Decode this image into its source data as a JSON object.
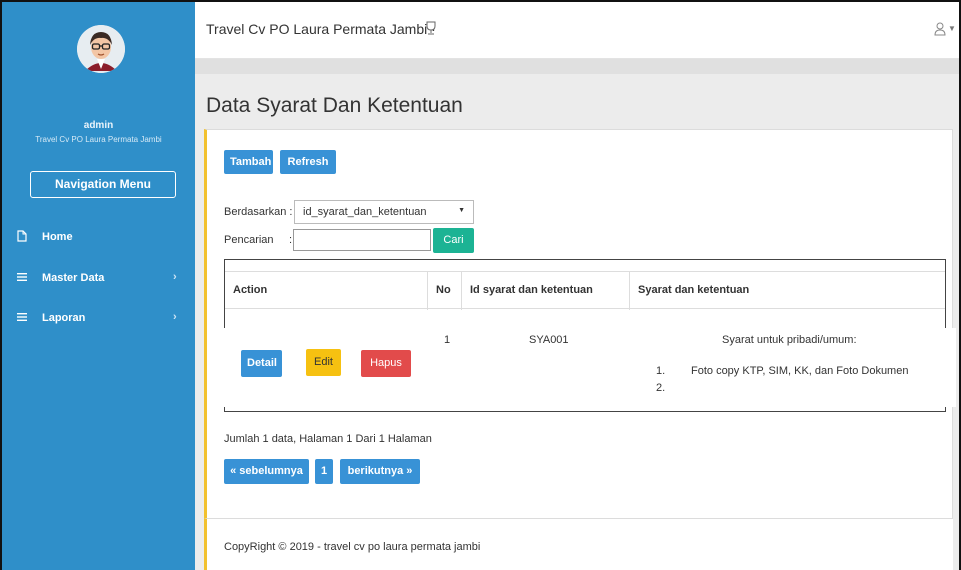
{
  "sidebar": {
    "username": "admin",
    "org": "Travel Cv PO Laura Permata Jambi",
    "nav_button": "Navigation Menu",
    "items": [
      {
        "label": "Home",
        "icon": "file-icon"
      },
      {
        "label": "Master Data",
        "icon": "menu-icon"
      },
      {
        "label": "Laporan",
        "icon": "menu-icon"
      }
    ]
  },
  "topbar": {
    "brand": "Travel Cv PO Laura Permata Jambi ·"
  },
  "page": {
    "title": "Data Syarat Dan Ketentuan"
  },
  "toolbar": {
    "add_label": "Tambah",
    "refresh_label": "Refresh"
  },
  "filter": {
    "by_label": "Berdasarkan :",
    "by_value": "id_syarat_dan_ketentuan",
    "search_label": "Pencarian",
    "search_colon": ":",
    "search_value": "",
    "search_button": "Cari"
  },
  "table": {
    "headers": [
      "Action",
      "No",
      "Id syarat dan ketentuan",
      "Syarat dan ketentuan"
    ],
    "rows": [
      {
        "actions": [
          "Detail",
          "Edit",
          "Hapus"
        ],
        "no": "1",
        "id": "SYA001",
        "syarat_title": "Syarat untuk pribadi/umum:",
        "syarat_items": [
          {
            "num": "1.",
            "text": "Foto copy KTP, SIM, KK, dan Foto Dokumen"
          },
          {
            "num": "2.",
            "text": ""
          }
        ]
      }
    ]
  },
  "summary": "Jumlah 1 data, Halaman 1 Dari 1 Halaman",
  "pagination": {
    "prev": "« sebelumnya",
    "current": "1",
    "next": "berikutnya »"
  },
  "footer": "CopyRight © 2019 - travel cv po laura permata jambi",
  "colors": {
    "sidebar": "#2f8fc9",
    "primary": "#3892d6",
    "success": "#1cb394",
    "warning": "#f6c111",
    "danger": "#e24b4b",
    "accent_border": "#f2c12e"
  }
}
